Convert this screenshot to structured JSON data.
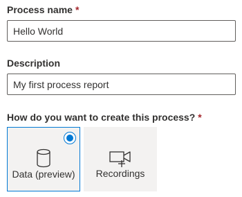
{
  "form": {
    "process_name": {
      "label": "Process name",
      "required_mark": "*",
      "value": "Hello World"
    },
    "description": {
      "label": "Description",
      "value": "My first process report"
    },
    "creation_method": {
      "label": "How do you want to create this process?",
      "required_mark": "*",
      "options": [
        {
          "label": "Data (preview)",
          "icon": "database-icon",
          "selected": true
        },
        {
          "label": "Recordings",
          "icon": "video-camera-add-icon",
          "selected": false
        }
      ]
    }
  },
  "colors": {
    "accent": "#0078d4",
    "required": "#a4262c",
    "card_background": "#f3f2f1",
    "text": "#323130"
  }
}
